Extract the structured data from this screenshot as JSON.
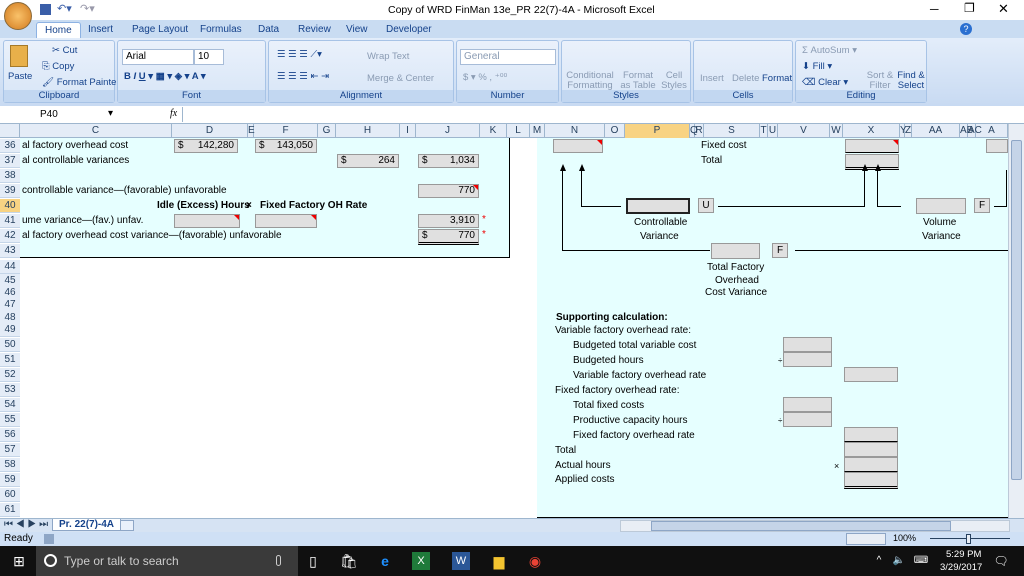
{
  "window": {
    "title": "Copy of WRD FinMan 13e_PR 22(7)-4A  -  Microsoft Excel"
  },
  "tabs": [
    "Home",
    "Insert",
    "Page Layout",
    "Formulas",
    "Data",
    "Review",
    "View",
    "Developer"
  ],
  "ribbon": {
    "clipboard": {
      "paste": "Paste",
      "cut": "Cut",
      "copy": "Copy",
      "format_painter": "Format Painter",
      "label": "Clipboard"
    },
    "font": {
      "name": "Arial",
      "size": "10",
      "label": "Font"
    },
    "alignment": {
      "wrap": "Wrap Text",
      "merge": "Merge & Center",
      "label": "Alignment"
    },
    "number": {
      "format": "General",
      "label": "Number"
    },
    "styles": {
      "conditional": "Conditional Formatting",
      "format_table": "Format as Table",
      "cell_styles": "Cell Styles",
      "label": "Styles"
    },
    "cells": {
      "insert": "Insert",
      "delete": "Delete",
      "format": "Format",
      "label": "Cells"
    },
    "editing": {
      "autosum": "AutoSum",
      "fill": "Fill",
      "clear": "Clear",
      "sort": "Sort & Filter",
      "find": "Find & Select",
      "label": "Editing"
    }
  },
  "formula_bar": {
    "name_box": "P40",
    "fx": "fx",
    "value": ""
  },
  "columns": [
    "C",
    "D",
    "E",
    "F",
    "G",
    "H",
    "I",
    "J",
    "K",
    "L",
    "M",
    "N",
    "O",
    "P",
    "Q",
    "R",
    "S",
    "T",
    "U",
    "V",
    "W",
    "X",
    "Y",
    "Z",
    "AA",
    "AB",
    "AC",
    "A"
  ],
  "selected_column": "P",
  "rows": [
    "36",
    "37",
    "38",
    "39",
    "40",
    "41",
    "42",
    "43",
    "44",
    "45",
    "46",
    "47",
    "48",
    "49",
    "50",
    "51",
    "52",
    "53",
    "54",
    "55",
    "56",
    "57",
    "58",
    "59",
    "60",
    "61"
  ],
  "selected_row": "40",
  "left": {
    "r36_label": "al factory overhead cost",
    "r36_d_cur": "$",
    "r36_d": "142,280",
    "r36_f_cur": "$",
    "r36_f": "143,050",
    "r37_label": "al controllable variances",
    "r37_h_cur": "$",
    "r37_h": "264",
    "r37_j_cur": "$",
    "r37_j": "1,034",
    "r39_label": "controllable variance—(favorable) unfavorable",
    "r39_j": "770",
    "r40_idle": "Idle (Excess) Hours",
    "r40_times": "×",
    "r40_rate": "Fixed Factory OH Rate",
    "r41_label": "ume variance—(fav.) unfav.",
    "r41_j": "3,910",
    "r41_star": "*",
    "r42_label": "al factory overhead cost variance—(favorable) unfavorable",
    "r42_j_cur": "$",
    "r42_j": "770",
    "r42_star": "*"
  },
  "diagram": {
    "fixed_cost": "Fixed cost",
    "total": "Total",
    "controllable_u": "U",
    "controllable_1": "Controllable",
    "controllable_2": "Variance",
    "volume_f": "F",
    "volume_1": "Volume",
    "volume_2": "Variance",
    "total_f": "F",
    "total_1": "Total Factory",
    "total_2": "Overhead",
    "total_3": "Cost Variance"
  },
  "support": {
    "title": "Supporting calculation:",
    "var_rate": "Variable factory overhead rate:",
    "budgeted_var": "Budgeted total variable cost",
    "budgeted_hours": "Budgeted hours",
    "div1": "÷",
    "var_rate_line": "Variable factory overhead rate",
    "fixed_rate": "Fixed factory overhead rate:",
    "total_fixed": "Total fixed costs",
    "capacity": "Productive capacity hours",
    "div2": "÷",
    "fixed_rate_line": "Fixed factory overhead rate",
    "total": "Total",
    "actual_hours": "Actual hours",
    "times": "×",
    "applied": "Applied costs"
  },
  "sheet_tab": "Pr. 22(7)-4A",
  "status": {
    "ready": "Ready",
    "zoom": "100%"
  },
  "taskbar": {
    "search": "Type or talk to search",
    "time": "5:29 PM",
    "date": "3/29/2017"
  }
}
